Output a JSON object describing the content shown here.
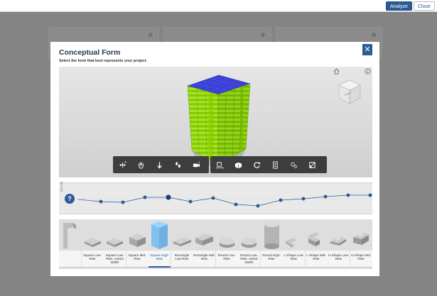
{
  "topbar": {
    "analyze_label": "Analyze",
    "close_label": "Close"
  },
  "modal": {
    "title": "Conceptual Form",
    "subtitle": "Select the form that best represents your project.",
    "close_glyph": "✕"
  },
  "viewer": {
    "cube_face": "LEFT"
  },
  "timeline": {
    "axis_label": "EUI ±00",
    "help_glyph": "?",
    "selected_index": 4
  },
  "forms": [
    {
      "label": "",
      "shape": "custom-l"
    },
    {
      "label": "Square Low-Rise",
      "shape": "square-low"
    },
    {
      "label": "Square Low-Rise, varied WWR",
      "shape": "square-low"
    },
    {
      "label": "Square Mid-Rise",
      "shape": "square-mid"
    },
    {
      "label": "Square High-Rise",
      "shape": "square-high",
      "selected": true
    },
    {
      "label": "Rectangle Low-Rise",
      "shape": "rect-low"
    },
    {
      "label": "Rectangle Mid-Rise",
      "shape": "rect-mid"
    },
    {
      "label": "Round Low-Rise",
      "shape": "round-low"
    },
    {
      "label": "Round Low-Rise, varied WWR",
      "shape": "round-low"
    },
    {
      "label": "Round High-Rise",
      "shape": "round-high"
    },
    {
      "label": "L-Shape Low-Rise",
      "shape": "l-low"
    },
    {
      "label": "L-Shape Mid-Rise",
      "shape": "l-mid"
    },
    {
      "label": "U-Shape Low-Rise",
      "shape": "u-low"
    },
    {
      "label": "U-Shape Mid-Rise",
      "shape": "u-mid"
    }
  ],
  "colors": {
    "accent": "#2b5c95",
    "glass": "#3a3fd6",
    "facade": "#8fd400"
  }
}
